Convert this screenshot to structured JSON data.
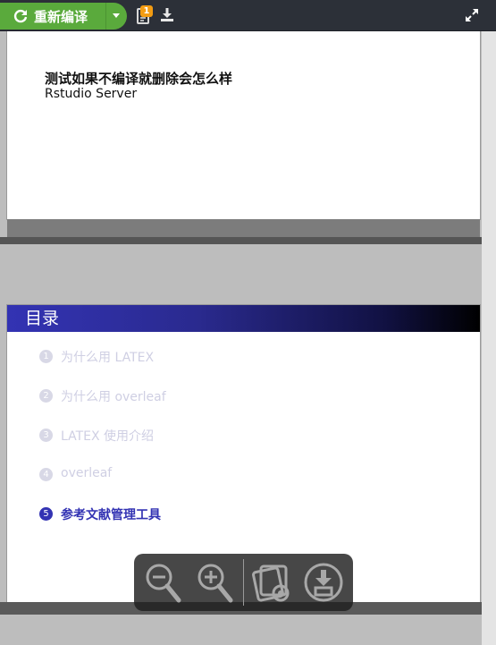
{
  "toolbar": {
    "recompile_label": "重新编译",
    "logs_badge": "1",
    "icons": [
      "refresh-icon",
      "chevron-down-icon",
      "logs-icon",
      "download-icon",
      "expand-icon"
    ]
  },
  "pdf": {
    "page1": {
      "title": "测试如果不编译就删除会怎么样",
      "subtitle": "Rstudio Server"
    },
    "page2": {
      "frame_title": "目录",
      "toc": [
        {
          "num": "1",
          "text": "为什么用 LATEX",
          "active": false
        },
        {
          "num": "2",
          "text": "为什么用 overleaf",
          "active": false
        },
        {
          "num": "3",
          "text": "LATEX 使用介绍",
          "active": false
        },
        {
          "num": "4",
          "text": "overleaf",
          "active": false
        },
        {
          "num": "5",
          "text": "参考文献管理工具",
          "active": true
        }
      ]
    }
  },
  "colors": {
    "accent_green": "#5aaa3c",
    "beamer_blue": "#3333b3",
    "badge_orange": "#f39c12"
  }
}
